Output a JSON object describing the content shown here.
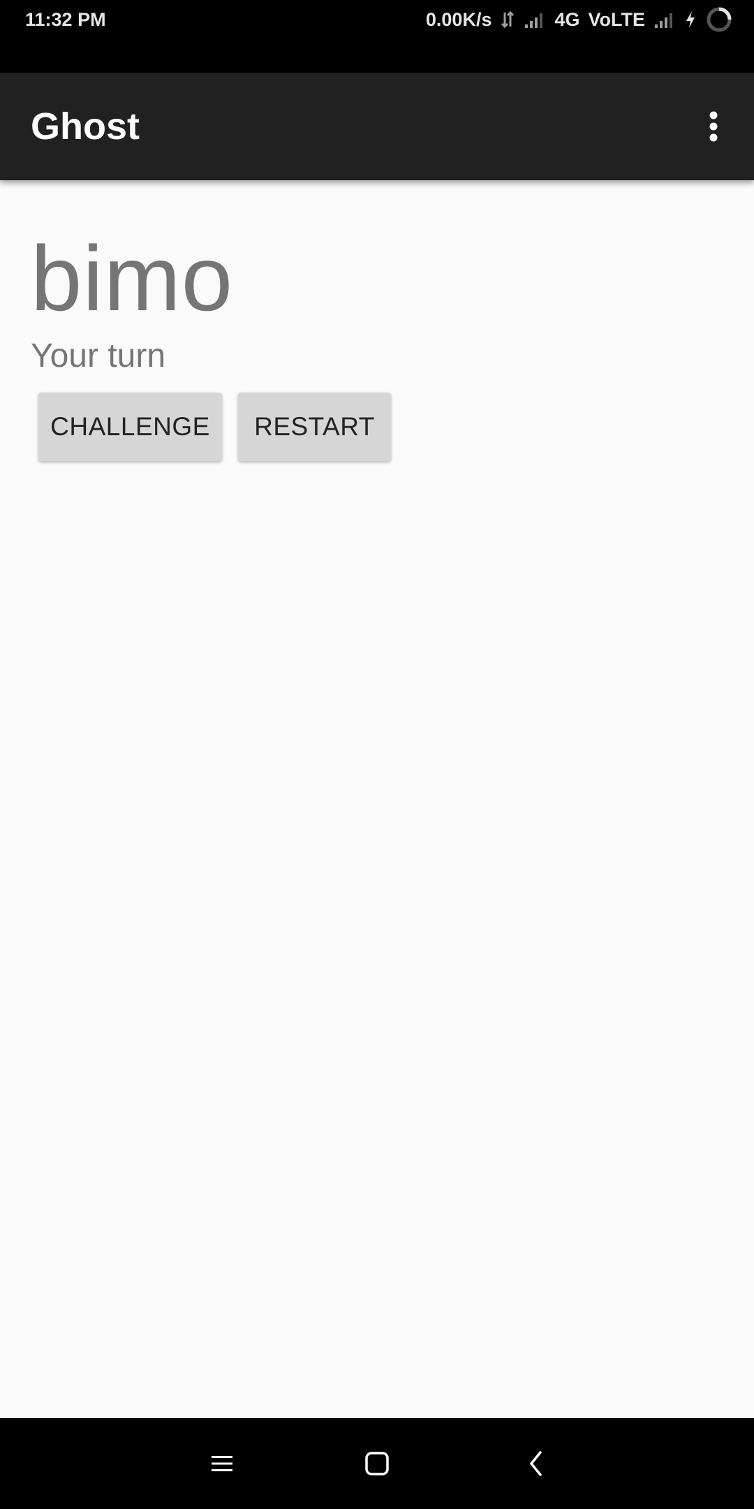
{
  "status_bar": {
    "time": "11:32 PM",
    "net_speed": "0.00K/s",
    "network_type": "4G",
    "volte": "VoLTE",
    "icons": [
      "data-transfer-icon",
      "signal-icon",
      "signal-icon",
      "charging-icon",
      "battery-icon"
    ]
  },
  "app_bar": {
    "title": "Ghost",
    "overflow_icon": "more-vert-icon",
    "background": "#212121"
  },
  "game": {
    "word": "bimo",
    "status": "Your turn",
    "challenge_label": "CHALLENGE",
    "restart_label": "RESTART"
  },
  "nav_bar": {
    "icons": [
      "menu-icon",
      "home-icon",
      "back-icon"
    ]
  },
  "colors": {
    "background": "#fafafa",
    "text_secondary": "#757575",
    "button_bg": "#d6d6d6"
  }
}
